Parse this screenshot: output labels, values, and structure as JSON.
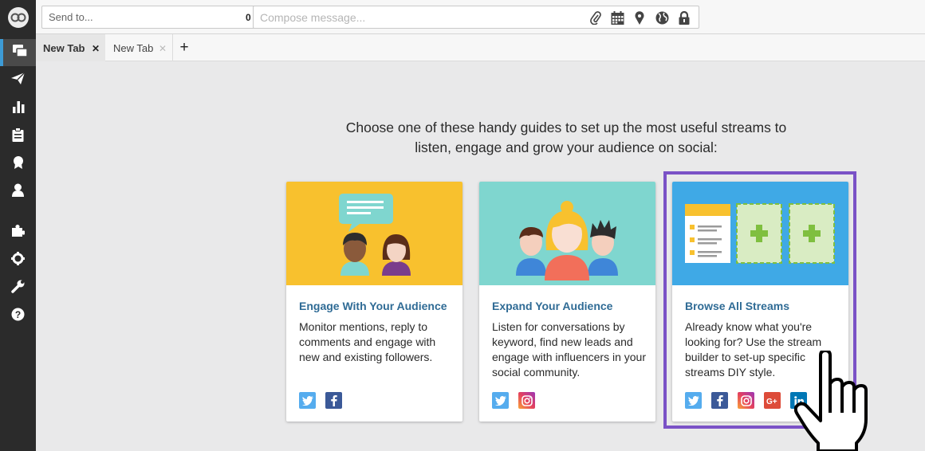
{
  "colors": {
    "sidebar_bg": "#2b2b2b",
    "accent_active": "#3d9bd6",
    "card_title": "#2f6b95",
    "highlight": "#7a52c6",
    "twitter": "#55acee",
    "facebook": "#3b5998",
    "googleplus": "#dd4b39",
    "linkedin": "#0077b5"
  },
  "sidebar": {
    "items": [
      {
        "icon": "streams-icon",
        "active": true
      },
      {
        "icon": "publisher-icon"
      },
      {
        "icon": "analytics-icon"
      },
      {
        "icon": "assignments-icon"
      },
      {
        "icon": "contests-icon"
      },
      {
        "icon": "contacts-icon"
      },
      {
        "icon": "apps-icon"
      },
      {
        "icon": "settings-icon"
      },
      {
        "icon": "tools-icon"
      },
      {
        "icon": "help-icon"
      }
    ]
  },
  "composer": {
    "send_to_placeholder": "Send to...",
    "send_to_count": "0",
    "compose_placeholder": "Compose message..."
  },
  "tabs": [
    {
      "label": "New Tab",
      "close": "✕",
      "active": true
    },
    {
      "label": "New Tab",
      "close": "✕",
      "active": false
    }
  ],
  "add_tab_label": "+",
  "main": {
    "intro_line1": "Choose one of these handy guides to set up the most useful streams to",
    "intro_line2": "listen, engage and grow your audience on social:",
    "cards": [
      {
        "title": "Engage With Your Audience",
        "description": "Monitor mentions, reply to comments and engage with new and existing followers.",
        "image_bg": "#f8c12e",
        "networks": [
          "twitter",
          "facebook"
        ]
      },
      {
        "title": "Expand Your Audience",
        "description": "Listen for conversations by keyword, find new leads and engage with influencers in your social community.",
        "image_bg": "#7fd6cf",
        "networks": [
          "twitter",
          "instagram"
        ]
      },
      {
        "title": "Browse All Streams",
        "description": "Already know what you're looking for? Use the stream builder to set-up specific streams DIY style.",
        "image_bg": "#3fa9e6",
        "networks": [
          "twitter",
          "facebook",
          "instagram",
          "googleplus",
          "linkedin"
        ],
        "highlighted": true
      }
    ]
  }
}
